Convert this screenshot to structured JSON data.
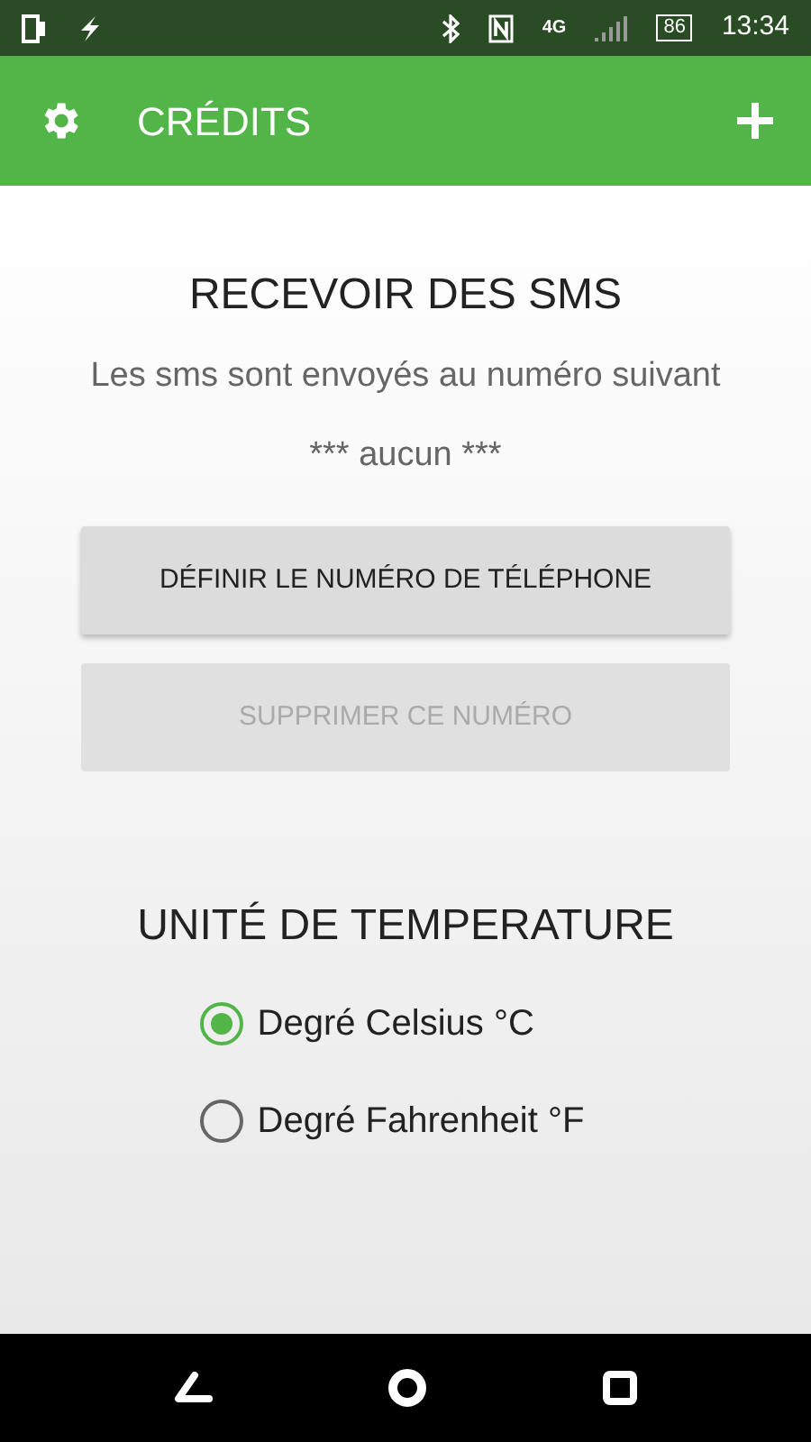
{
  "status_bar": {
    "network": "4G",
    "battery": "86",
    "time": "13:34"
  },
  "app_bar": {
    "title": "CRÉDITS"
  },
  "sms": {
    "heading": "RECEVOIR DES SMS",
    "description": "Les sms sont envoyés au numéro suivant",
    "number": "*** aucun ***",
    "buttons": [
      {
        "label": "DÉFINIR LE NUMÉRO DE TÉLÉPHONE",
        "disabled": false
      },
      {
        "label": "SUPPRIMER CE NUMÉRO",
        "disabled": true
      }
    ]
  },
  "temperature": {
    "heading": "UNITÉ DE TEMPERATURE",
    "options": [
      {
        "label": "Degré Celsius °C",
        "selected": true
      },
      {
        "label": "Degré Fahrenheit °F",
        "selected": false
      }
    ]
  }
}
